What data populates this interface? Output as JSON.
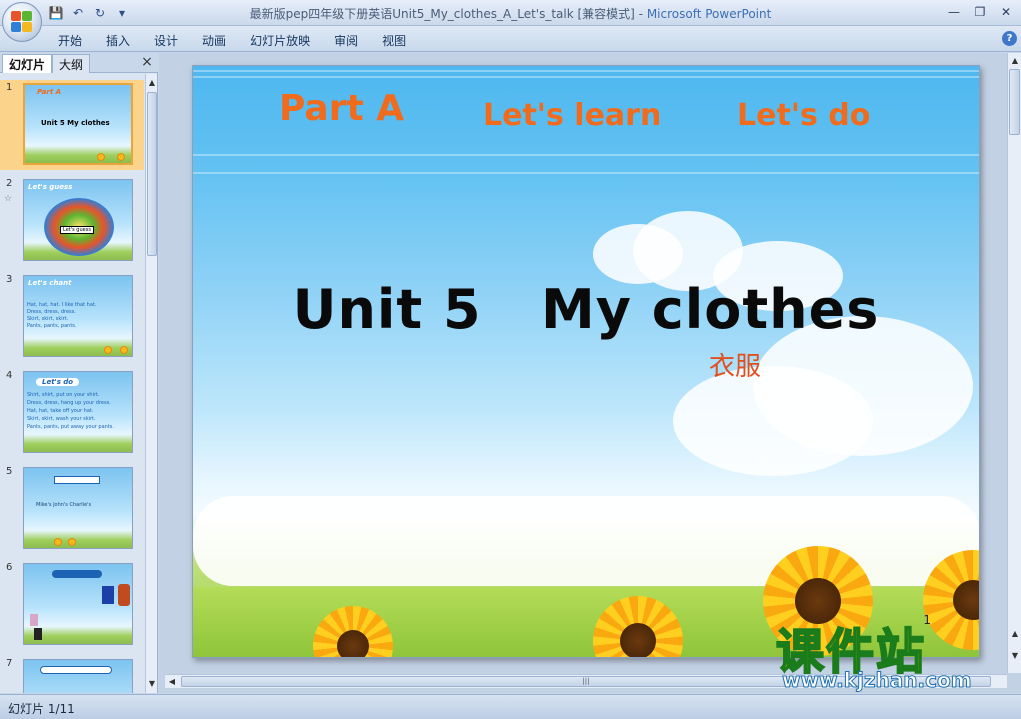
{
  "window": {
    "title": "最新版pep四年级下册英语Unit5_My_clothes_A_Let's_talk [兼容模式]",
    "title_sep": " - ",
    "app_name": "Microsoft PowerPoint"
  },
  "qat": {
    "save_icon": "save-icon",
    "undo_icon": "undo-icon",
    "redo_icon": "redo-icon",
    "customize_icon": "dropdown-icon"
  },
  "ribbon": {
    "tabs": [
      "开始",
      "插入",
      "设计",
      "动画",
      "幻灯片放映",
      "审阅",
      "视图"
    ],
    "help": "?"
  },
  "left_pane": {
    "tab_slides": "幻灯片",
    "tab_outline": "大纲",
    "close": "×",
    "thumbnails": [
      {
        "num": "1",
        "title": "Part A",
        "lines": [
          "Unit 5   My clothes"
        ],
        "selected": true
      },
      {
        "num": "2",
        "title": "Let's guess",
        "lines": [
          "Let's guess"
        ],
        "selected": false
      },
      {
        "num": "3",
        "title": "Let's chant",
        "lines": [
          "Hat, hat, hat.   I like that hat.",
          "Dress, dress, dress. ",
          "Skirt, skirt, skirt.",
          "Pants, pants, pants."
        ],
        "selected": false
      },
      {
        "num": "4",
        "title": "Let's do",
        "lines": [
          "Shirt, shirt, put on your shirt.",
          "Dress, dress, hang up your dress.",
          "Hat, hat, take off your hat.",
          "Skirt, skirt, wash your skirt.",
          "Pants, pants, put away your pants."
        ],
        "selected": false
      },
      {
        "num": "5",
        "title": "",
        "lines": [
          "Mike's  John's  Charlie's"
        ],
        "selected": false
      },
      {
        "num": "6",
        "title": "",
        "lines": [],
        "selected": false
      },
      {
        "num": "7",
        "title": "",
        "lines": [],
        "selected": false
      }
    ]
  },
  "slide": {
    "heading_part": "Part A",
    "heading_learn": "Let's learn",
    "heading_do": "Let's do",
    "title": "Unit 5   My clothes",
    "subtitle_cn": "衣服",
    "page_number": "1"
  },
  "watermark": {
    "cn": "课件站",
    "url": "www.kjzhan.com"
  },
  "status": {
    "slide_counter": "幻灯片 1/11"
  }
}
